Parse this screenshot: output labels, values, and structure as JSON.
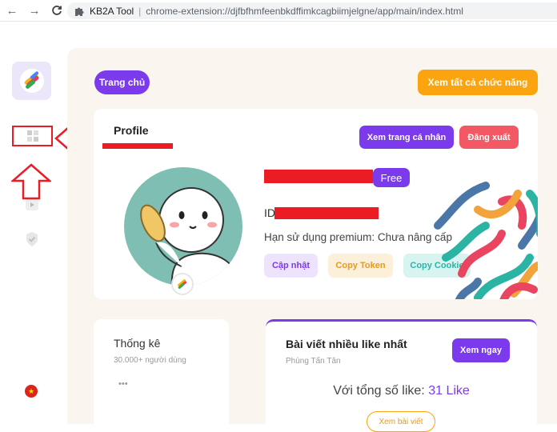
{
  "browser": {
    "extension_name": "KB2A Tool",
    "url": "chrome-extension://djfbfhmfeenbkdffimkcagbiimjelgne/app/main/index.html"
  },
  "header": {
    "home_label": "Trang chủ",
    "all_features_label": "Xem tất cả chức năng"
  },
  "profile": {
    "title": "Profile",
    "view_profile_label": "Xem trang cá nhân",
    "logout_label": "Đăng xuất",
    "plan_badge": "Free",
    "id_prefix": "ID",
    "premium_text": "Hạn sử dụng premium: Chưa nâng cấp",
    "update_label": "Cập nhật",
    "copy_token_label": "Copy Token",
    "copy_cookie_label": "Copy Cookie"
  },
  "stats": {
    "title": "Thống kê",
    "subtitle": "30.000+ người dùng",
    "more": "•••"
  },
  "top_post": {
    "title": "Bài viết nhiều like nhất",
    "author": "Phùng Tấn Tân",
    "view_now_label": "Xem ngay",
    "likes_prefix": "Với tổng số like:",
    "likes_value": "31 Like",
    "view_post_label": "Xem bài viết"
  },
  "colors": {
    "accent_purple": "#7c3aed",
    "accent_orange": "#fba40f",
    "accent_red": "#f25965",
    "annotation_red": "#ec1c24"
  }
}
